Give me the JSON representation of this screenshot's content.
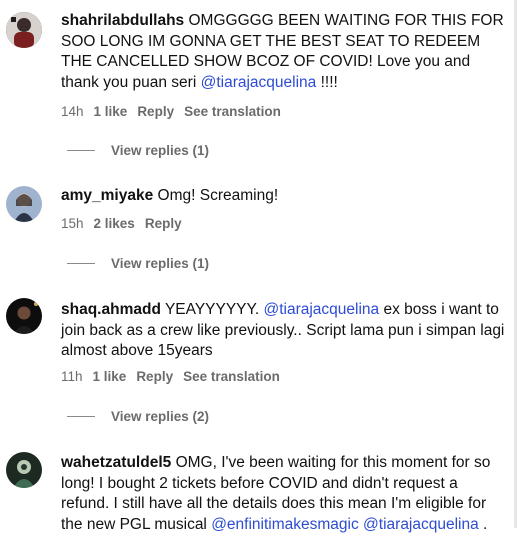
{
  "comments": [
    {
      "username": "shahrilabdullahs",
      "text_parts": [
        "OMGGGGG BEEN WAITING FOR THIS FOR SOO LONG IM GONNA GET THE BEST SEAT TO REDEEM THE CANCELLED SHOW BCOZ OF COVID! Love you and thank you puan seri ",
        "@tiarajacquelina",
        " !!!!"
      ],
      "time": "14h",
      "likes": "1 like",
      "reply": "Reply",
      "translation": "See translation",
      "view_replies": "View replies (1)",
      "avatar_color": "#3a2a2a"
    },
    {
      "username": "amy_miyake",
      "text_parts": [
        "Omg! Screaming!"
      ],
      "time": "15h",
      "likes": "2 likes",
      "reply": "Reply",
      "view_replies": "View replies (1)",
      "avatar_color": "#6f86a8"
    },
    {
      "username": "shaq.ahmadd",
      "text_parts": [
        "YEAYYYYYY. ",
        "@tiarajacquelina",
        " ex boss i want to join back as a crew like previously.. Script lama pun i simpan lagi almost above 15years"
      ],
      "time": "11h",
      "likes": "1 like",
      "reply": "Reply",
      "translation": "See translation",
      "view_replies": "View replies (2)",
      "avatar_color": "#111111"
    },
    {
      "username": "wahetzatuldel5",
      "text_parts": [
        "OMG, I've been waiting for this moment for so long! I bought 2 tickets before COVID and didn't request a refund. I still have all the details does this mean I'm eligible for the new PGL musical ",
        "@enfinitimakesmagic",
        " ",
        "@tiarajacquelina",
        " ."
      ],
      "avatar_color": "#24382c"
    }
  ]
}
